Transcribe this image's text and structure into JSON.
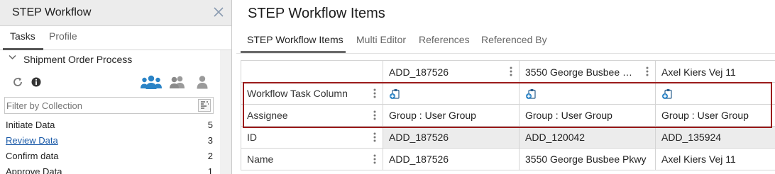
{
  "left_panel": {
    "title": "STEP Workflow",
    "tabs": [
      {
        "label": "Tasks",
        "active": true
      },
      {
        "label": "Profile",
        "active": false
      }
    ],
    "process": {
      "label": "Shipment Order Process",
      "expanded": true
    },
    "icons": [
      "refresh-icon",
      "info-icon",
      "group-users-icon",
      "users-icon",
      "user-icon"
    ],
    "filter": {
      "placeholder": "Filter by Collection",
      "value": ""
    },
    "tasks": [
      {
        "name": "Initiate Data",
        "count": "5",
        "link": false
      },
      {
        "name": "Review Data",
        "count": "3",
        "link": true
      },
      {
        "name": "Confirm data",
        "count": "2",
        "link": false
      },
      {
        "name": "Approve Data",
        "count": "1",
        "link": false
      }
    ]
  },
  "right_panel": {
    "title": "STEP Workflow Items",
    "tabs": [
      {
        "label": "STEP Workflow Items",
        "active": true
      },
      {
        "label": "Multi Editor",
        "active": false
      },
      {
        "label": "References",
        "active": false
      },
      {
        "label": "Referenced By",
        "active": false
      }
    ],
    "grid": {
      "columns": [
        "ADD_187526",
        "3550 George Busbee Pk...",
        "Axel Kiers Vej 11"
      ],
      "rows": [
        {
          "label": "Workflow Task Column",
          "type": "icon",
          "cells": [
            "",
            "",
            ""
          ]
        },
        {
          "label": "Assignee",
          "type": "text",
          "cells": [
            "Group : User Group",
            "Group : User Group",
            "Group : User Group"
          ]
        },
        {
          "label": "ID",
          "type": "text",
          "gray": true,
          "cells": [
            "ADD_187526",
            "ADD_120042",
            "ADD_135924"
          ]
        },
        {
          "label": "Name",
          "type": "text",
          "cells": [
            "ADD_187526",
            "3550 George Busbee Pkwy",
            "Axel Kiers Vej 11"
          ]
        }
      ]
    }
  },
  "colors": {
    "accent_blue": "#2a83c6",
    "link_blue": "#1a5aa8",
    "highlight_red": "#9b1b1b",
    "icon_gray": "#8a8a8a"
  }
}
